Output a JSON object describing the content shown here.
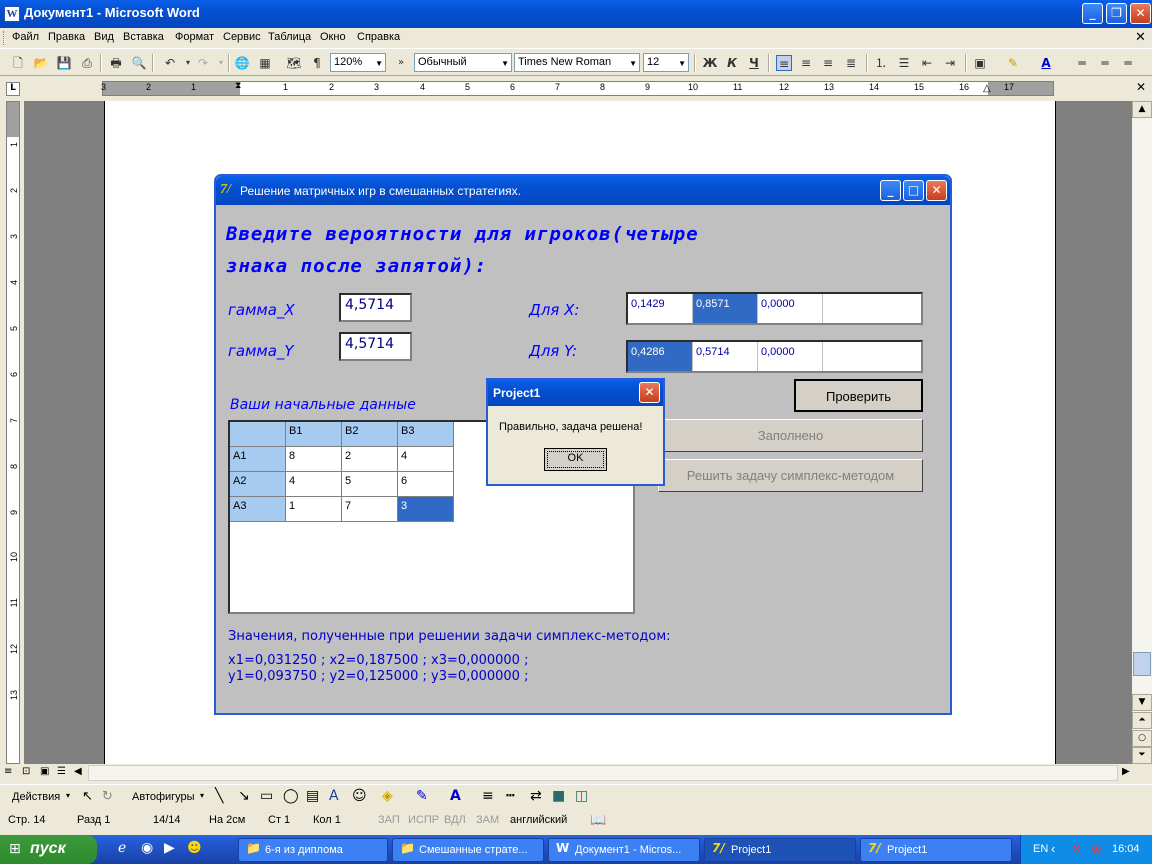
{
  "word": {
    "title": "Документ1 - Microsoft Word",
    "menu": [
      "Файл",
      "Правка",
      "Вид",
      "Вставка",
      "Формат",
      "Сервис",
      "Таблица",
      "Окно",
      "Справка"
    ],
    "zoom": "120%",
    "style": "Обычный",
    "font": "Times New Roman",
    "size": "12"
  },
  "ruler": {
    "numbers": [
      "3",
      "2",
      "1",
      "1",
      "2",
      "3",
      "4",
      "5",
      "6",
      "7",
      "8",
      "9",
      "10",
      "11",
      "12",
      "13",
      "14",
      "15",
      "16",
      "17"
    ],
    "vnumbers": [
      "1",
      "2",
      "3",
      "4",
      "5",
      "6",
      "7",
      "8",
      "9",
      "10",
      "11",
      "12",
      "13"
    ]
  },
  "app": {
    "title": "Решение матричных игр в смешанных стратегиях.",
    "heading1": "Введите вероятности для игроков(четыре",
    "heading2": "знака после запятой):",
    "gamma_x_label": "гамма_X",
    "gamma_x_value": "4,5714",
    "gamma_y_label": "гамма_Y",
    "gamma_y_value": "4,5714",
    "forx_label": "Для X:",
    "fory_label": "Для Y:",
    "px": [
      "0,1429",
      "0,8571",
      "0,0000"
    ],
    "py": [
      "0,4286",
      "0,5714",
      "0,0000"
    ],
    "check_button": "Проверить",
    "filled_button": "Заполнено",
    "simplex_button": "Решить задачу симплекс-методом",
    "initial_label": "Ваши начальные данные",
    "grid": {
      "cols": [
        "B1",
        "B2",
        "B3"
      ],
      "rows": [
        {
          "name": "A1",
          "values": [
            "8",
            "2",
            "4"
          ]
        },
        {
          "name": "A2",
          "values": [
            "4",
            "5",
            "6"
          ]
        },
        {
          "name": "A3",
          "values": [
            "1",
            "7",
            "3"
          ]
        }
      ]
    },
    "results_title": "Значения, полученные при решении задачи симплекс-методом:",
    "results_x": "x1=0,031250 ; x2=0,187500 ; x3=0,000000 ;",
    "results_y": "y1=0,093750 ; y2=0,125000 ; y3=0,000000 ;"
  },
  "msgbox": {
    "title": "Project1",
    "text": "Правильно, задача решена!",
    "ok": "OK"
  },
  "drawbar": {
    "actions": "Действия",
    "autoshapes": "Автофигуры"
  },
  "status": {
    "page": "Стр. 14",
    "section": "Разд 1",
    "pages": "14/14",
    "at": "На 2см",
    "line": "Ст 1",
    "col": "Кол 1",
    "rec": "ЗАП",
    "trk": "ИСПР",
    "ext": "ВДЛ",
    "ovr": "ЗАМ",
    "lang": "английский"
  },
  "taskbar": {
    "start": "пуск",
    "tasks": [
      "6-я из диплома",
      "Смешанные страте...",
      "Документ1 - Micros...",
      "Project1",
      "Project1"
    ],
    "lang": "EN",
    "time": "16:04"
  }
}
